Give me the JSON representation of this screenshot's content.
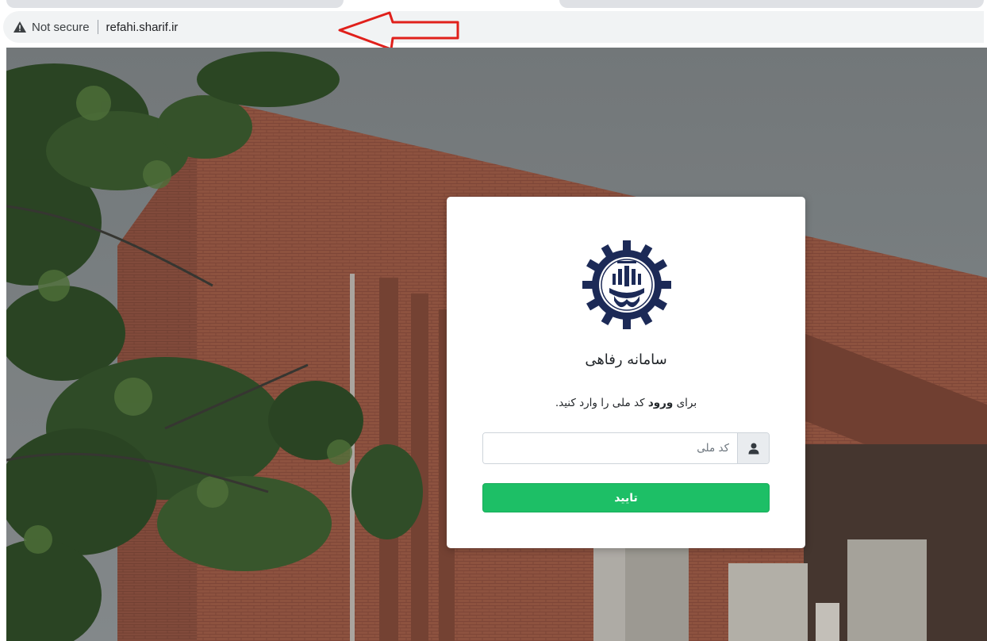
{
  "browser": {
    "security_label": "Not secure",
    "url": "refahi.sharif.ir",
    "warning_color": "#3c4043",
    "annotation_arrow_color": "#e0201b"
  },
  "login": {
    "title": "سامانه رفاهی",
    "description_prefix": "برای",
    "description_bold": "ورود",
    "description_suffix": "کد ملی را وارد کنید.",
    "national_code_placeholder": "کد ملی",
    "submit_label": "تایید",
    "submit_color": "#1dbf66",
    "user_icon": "user-icon"
  },
  "logo": {
    "name": "sharif-university-seal"
  }
}
